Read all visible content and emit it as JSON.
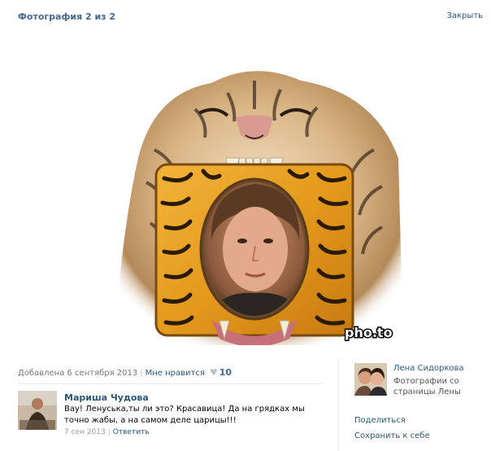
{
  "header": {
    "title": "Фотография 2 из 2",
    "close_label": "Закрыть"
  },
  "photo": {
    "watermark": "pho.to"
  },
  "meta": {
    "added_label": "Добавлена 6 сентября 2013",
    "like_label": "Мне нравится",
    "like_count": "10"
  },
  "comments": [
    {
      "author": "Мариша Чудова",
      "text": "Вау! Ленуська,ты ли это? Красавица! Да на грядках мы точно жабы, а на самом деле царицы!!!",
      "date": "7 сен 2013",
      "reply_label": "Ответить"
    }
  ],
  "sidebar": {
    "owner_name": "Лена Сидоркова",
    "album_label": "Фотографии со страницы Лены",
    "share_label": "Поделиться",
    "save_label": "Сохранить к себе"
  },
  "colors": {
    "link": "#2b587a",
    "header": "#45688e",
    "muted": "#777777"
  }
}
